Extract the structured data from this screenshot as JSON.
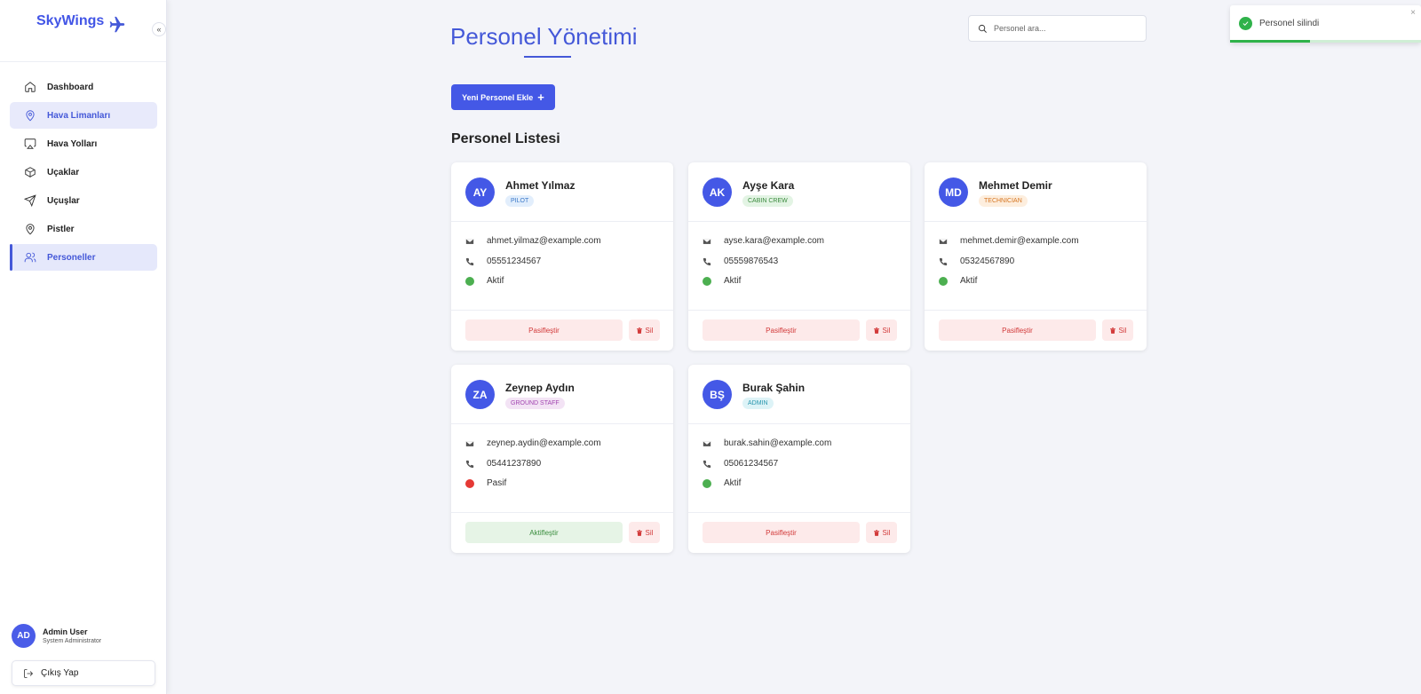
{
  "app": {
    "brand": "SkyWings"
  },
  "sidebar": {
    "collapse_glyph": "«",
    "items": [
      {
        "label": "Dashboard",
        "icon": "home-icon"
      },
      {
        "label": "Hava Limanları",
        "icon": "map-pin-icon"
      },
      {
        "label": "Hava Yolları",
        "icon": "airplay-icon"
      },
      {
        "label": "Uçaklar",
        "icon": "box-icon"
      },
      {
        "label": "Uçuşlar",
        "icon": "send-icon"
      },
      {
        "label": "Pistler",
        "icon": "map-pin-icon"
      },
      {
        "label": "Personeller",
        "icon": "users-icon"
      }
    ],
    "user": {
      "initials": "AD",
      "name": "Admin User",
      "role": "System Administrator"
    },
    "logout_label": "Çıkış Yap"
  },
  "header": {
    "title": "Personel Yönetimi",
    "search_placeholder": "Personel ara..."
  },
  "actions": {
    "add_label": "Yeni Personel Ekle",
    "add_glyph": "+"
  },
  "list": {
    "title": "Personel Listesi",
    "delete_label": "Sil",
    "cards": [
      {
        "initials": "AY",
        "name": "Ahmet Yılmaz",
        "role": "PILOT",
        "email": "ahmet.yilmaz@example.com",
        "phone": "05551234567",
        "status": "Aktif",
        "toggle_label": "Pasifleştir"
      },
      {
        "initials": "AK",
        "name": "Ayşe Kara",
        "role": "CABIN CREW",
        "email": "ayse.kara@example.com",
        "phone": "05559876543",
        "status": "Aktif",
        "toggle_label": "Pasifleştir"
      },
      {
        "initials": "MD",
        "name": "Mehmet Demir",
        "role": "TECHNICIAN",
        "email": "mehmet.demir@example.com",
        "phone": "05324567890",
        "status": "Aktif",
        "toggle_label": "Pasifleştir"
      },
      {
        "initials": "ZA",
        "name": "Zeynep Aydın",
        "role": "GROUND STAFF",
        "email": "zeynep.aydin@example.com",
        "phone": "05441237890",
        "status": "Pasif",
        "toggle_label": "Aktifleştir"
      },
      {
        "initials": "BŞ",
        "name": "Burak Şahin",
        "role": "ADMIN",
        "email": "burak.sahin@example.com",
        "phone": "05061234567",
        "status": "Aktif",
        "toggle_label": "Pasifleştir"
      }
    ]
  },
  "toast": {
    "message": "Personel silindi",
    "close_glyph": "×",
    "progress": 0.42
  },
  "colors": {
    "accent": "#4458e6",
    "active_status": "#4caf50",
    "passive_status": "#e53935",
    "success": "#2fb24a"
  }
}
